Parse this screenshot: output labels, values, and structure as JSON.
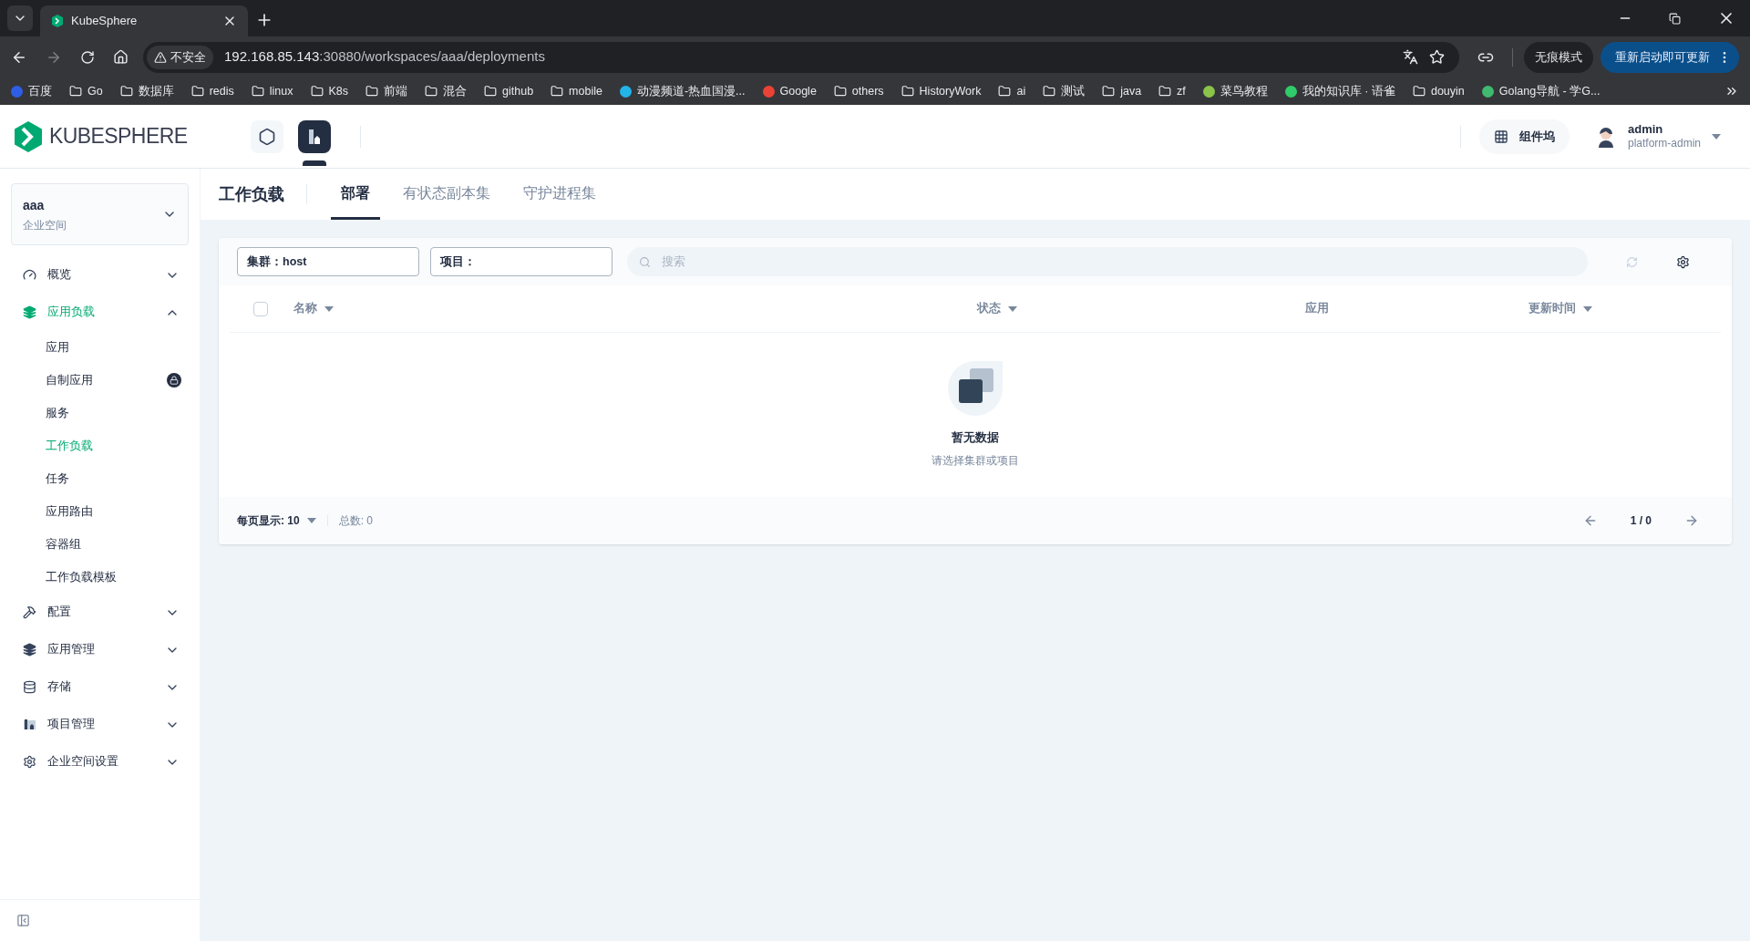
{
  "browser": {
    "tab_title": "KubeSphere",
    "security_label": "不安全",
    "url_host": "192.168.85.143",
    "url_rest": ":30880/workspaces/aaa/deployments",
    "incognito_label": "无痕模式",
    "update_button": "重新启动即可更新",
    "bookmarks": [
      {
        "label": "百度",
        "kind": "site",
        "color": "#2f5ee6"
      },
      {
        "label": "Go",
        "kind": "folder"
      },
      {
        "label": "数据库",
        "kind": "folder"
      },
      {
        "label": "redis",
        "kind": "folder"
      },
      {
        "label": "linux",
        "kind": "folder"
      },
      {
        "label": "K8s",
        "kind": "folder"
      },
      {
        "label": "前端",
        "kind": "folder"
      },
      {
        "label": "混合",
        "kind": "folder"
      },
      {
        "label": "github",
        "kind": "folder"
      },
      {
        "label": "mobile",
        "kind": "folder"
      },
      {
        "label": "动漫频道-热血国漫...",
        "kind": "site",
        "color": "#22b3e8"
      },
      {
        "label": "Google",
        "kind": "site",
        "color": "#ea4335"
      },
      {
        "label": "others",
        "kind": "folder"
      },
      {
        "label": "HistoryWork",
        "kind": "folder"
      },
      {
        "label": "ai",
        "kind": "folder"
      },
      {
        "label": "测试",
        "kind": "folder"
      },
      {
        "label": "java",
        "kind": "folder"
      },
      {
        "label": "zf",
        "kind": "folder"
      },
      {
        "label": "菜鸟教程",
        "kind": "site",
        "color": "#8bc34a"
      },
      {
        "label": "我的知识库 · 语雀",
        "kind": "site",
        "color": "#31cc6a"
      },
      {
        "label": "douyin",
        "kind": "folder"
      },
      {
        "label": "Golang导航 - 学G...",
        "kind": "site",
        "color": "#3fba6e"
      }
    ]
  },
  "header": {
    "logo_text": "KUBESPHERE",
    "nav": [
      {
        "kind": "platform",
        "selected": false
      },
      {
        "kind": "workspace",
        "selected": true
      }
    ],
    "toolbox_label": "组件坞",
    "user_name": "admin",
    "user_role": "platform-admin"
  },
  "sidebar": {
    "workspace_name": "aaa",
    "workspace_type": "企业空间",
    "items": [
      {
        "label": "概览",
        "kind": "gauge",
        "expanded": false,
        "selected": false
      },
      {
        "label": "应用负载",
        "kind": "layers",
        "expanded": true,
        "selected": true,
        "children": [
          {
            "label": "应用",
            "selected": false,
            "locked": false
          },
          {
            "label": "自制应用",
            "selected": false,
            "locked": true
          },
          {
            "label": "服务",
            "selected": false,
            "locked": false
          },
          {
            "label": "工作负载",
            "selected": true,
            "locked": false
          },
          {
            "label": "任务",
            "selected": false,
            "locked": false
          },
          {
            "label": "应用路由",
            "selected": false,
            "locked": false
          },
          {
            "label": "容器组",
            "selected": false,
            "locked": false
          },
          {
            "label": "工作负载模板",
            "selected": false,
            "locked": false
          }
        ]
      },
      {
        "label": "配置",
        "kind": "hammer",
        "expanded": false,
        "selected": false
      },
      {
        "label": "应用管理",
        "kind": "layers",
        "expanded": false,
        "selected": false
      },
      {
        "label": "存储",
        "kind": "database",
        "expanded": false,
        "selected": false
      },
      {
        "label": "项目管理",
        "kind": "project",
        "expanded": false,
        "selected": false
      },
      {
        "label": "企业空间设置",
        "kind": "gear",
        "expanded": false,
        "selected": false
      }
    ]
  },
  "page": {
    "title": "工作负载",
    "tabs": [
      {
        "label": "部署",
        "selected": true
      },
      {
        "label": "有状态副本集",
        "selected": false
      },
      {
        "label": "守护进程集",
        "selected": false
      }
    ]
  },
  "filters": {
    "cluster_label": "集群：",
    "cluster_value": "host",
    "project_label": "项目：",
    "search_placeholder": "搜索"
  },
  "table": {
    "select_all_checked": false,
    "columns": [
      {
        "label": "名称",
        "sortable": true
      },
      {
        "label": "状态",
        "sortable": true
      },
      {
        "label": "应用",
        "sortable": false
      },
      {
        "label": "更新时间",
        "sortable": true
      }
    ],
    "empty_title": "暂无数据",
    "empty_hint": "请选择集群或项目"
  },
  "footer": {
    "page_size_label": "每页显示: 10",
    "total": "总数: 0",
    "pages": "1 / 0"
  }
}
